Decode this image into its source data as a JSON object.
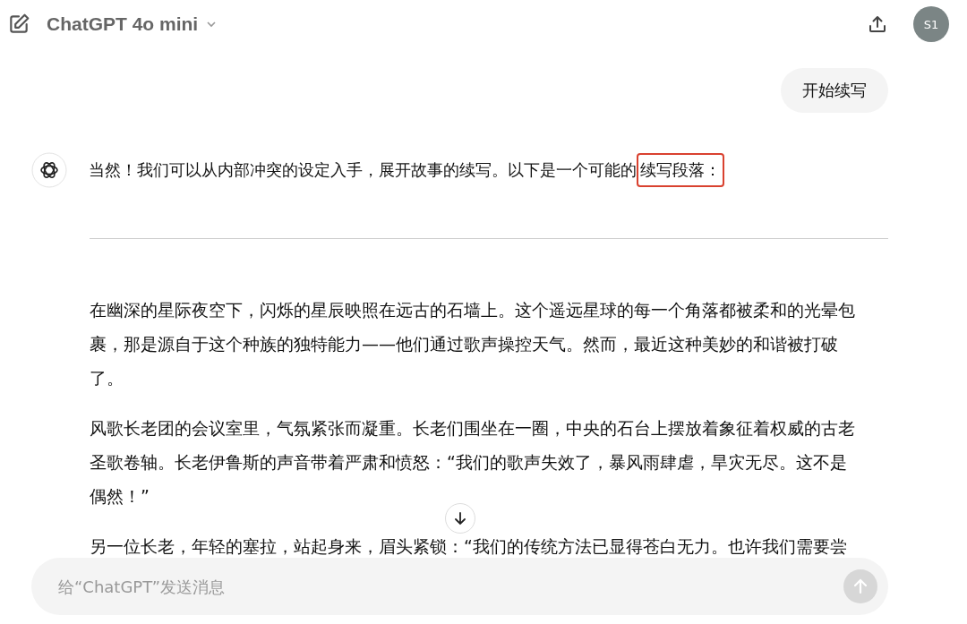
{
  "header": {
    "model": "ChatGPT 4o mini",
    "avatar": "S1"
  },
  "user_message": "开始续写",
  "assistant_intro": {
    "text": "当然！我们可以从内部冲突的设定入手，展开故事的续写。以下是一个可能的",
    "highlighted": "续写段落："
  },
  "paragraphs": [
    "在幽深的星际夜空下，闪烁的星辰映照在远古的石墙上。这个遥远星球的每一个角落都被柔和的光晕包裹，那是源自于这个种族的独特能力——他们通过歌声操控天气。然而，最近这种美妙的和谐被打破了。",
    "风歌长老团的会议室里，气氛紧张而凝重。长老们围坐在一圈，中央的石台上摆放着象征着权威的古老圣歌卷轴。长老伊鲁斯的声音带着严肃和愤怒：“我们的歌声失效了，暴风雨肆虐，旱灾无尽。这不是偶然！”",
    "另一位长老，年轻的塞拉，站起身来，眉头紧锁：“我们的传统方法已显得苍白无力。也许我们需要尝"
  ],
  "composer": {
    "placeholder": "给“ChatGPT”发送消息"
  }
}
